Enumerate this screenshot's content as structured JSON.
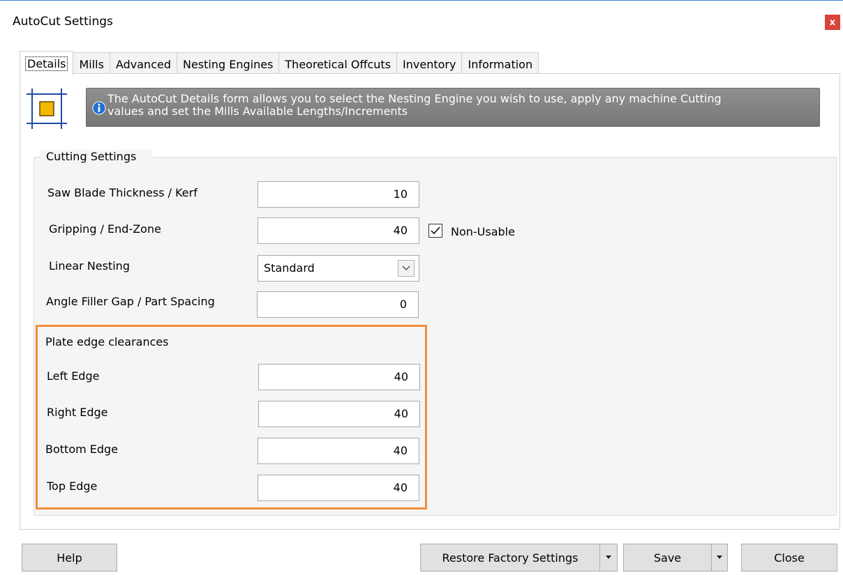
{
  "window": {
    "title": "AutoCut Settings",
    "close_glyph": "x"
  },
  "tabs": [
    {
      "label": "Details"
    },
    {
      "label": "Mills"
    },
    {
      "label": "Advanced"
    },
    {
      "label": "Nesting Engines"
    },
    {
      "label": "Theoretical Offcuts"
    },
    {
      "label": "Inventory"
    },
    {
      "label": "Information"
    }
  ],
  "info": {
    "line1": "The AutoCut Details form allows you to select the Nesting Engine you wish to use, apply any machine Cutting",
    "line2": "values and set the Mills Available Lengths/Increments",
    "icon": "info-icon"
  },
  "cutting": {
    "title": "Cutting Settings",
    "kerf_label": "Saw Blade Thickness / Kerf",
    "kerf_value": "10",
    "grip_label": "Gripping / End-Zone",
    "grip_value": "40",
    "non_usable_label": "Non-Usable",
    "non_usable_checked": true,
    "nesting_label": "Linear Nesting",
    "nesting_value": "Standard",
    "gap_label": "Angle Filler Gap / Part Spacing",
    "gap_value": "0"
  },
  "plate": {
    "title": "Plate edge clearances",
    "left_label": "Left Edge",
    "left_value": "40",
    "right_label": "Right Edge",
    "right_value": "40",
    "bottom_label": "Bottom Edge",
    "bottom_value": "40",
    "top_label": "Top Edge",
    "top_value": "40",
    "highlight_color": "#f08c3a"
  },
  "footer": {
    "help": "Help",
    "restore": "Restore Factory Settings",
    "save": "Save",
    "close": "Close"
  }
}
